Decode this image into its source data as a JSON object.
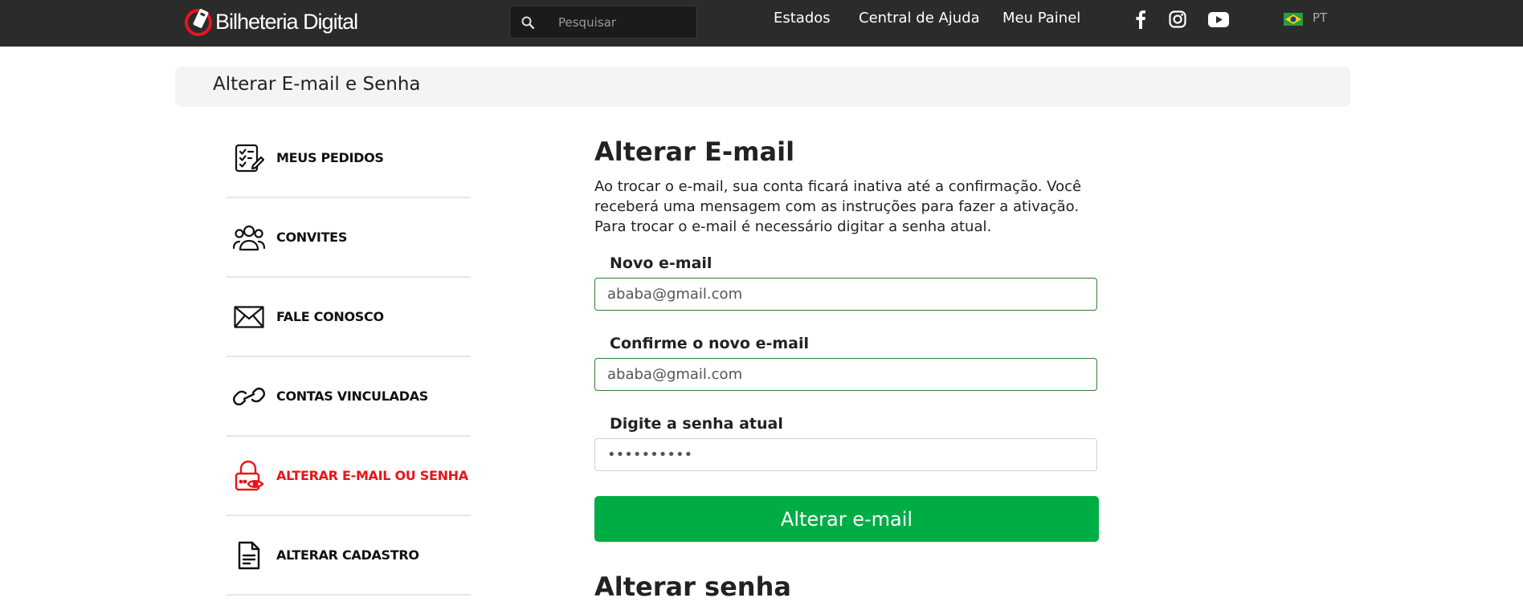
{
  "header": {
    "logo_text": "Bilheteria Digital",
    "search_placeholder": "Pesquisar",
    "nav": [
      "Estados",
      "Central de Ajuda",
      "Meu Painel"
    ],
    "language": "PT"
  },
  "page_title": "Alterar E-mail e Senha",
  "sidebar": {
    "items": [
      {
        "label": "MEUS PEDIDOS",
        "icon": "checklist-icon"
      },
      {
        "label": "CONVITES",
        "icon": "users-icon"
      },
      {
        "label": "FALE CONOSCO",
        "icon": "envelope-icon"
      },
      {
        "label": "CONTAS VINCULADAS",
        "icon": "link-icon"
      },
      {
        "label": "ALTERAR E-MAIL OU SENHA",
        "icon": "lock-eye-icon",
        "active": true
      },
      {
        "label": "ALTERAR CADASTRO",
        "icon": "document-icon"
      }
    ]
  },
  "form": {
    "title": "Alterar E-mail",
    "description": "Ao trocar o e-mail, sua conta ficará inativa até a confirmação. Você receberá uma mensagem com as instruções para fazer a ativação. Para trocar o e-mail é necessário digitar a senha atual.",
    "new_email_label": "Novo e-mail",
    "new_email_value": "ababa@gmail.com",
    "confirm_email_label": "Confirme o novo e-mail",
    "confirm_email_value": "ababa@gmail.com",
    "password_label": "Digite a senha atual",
    "password_value": "••••••••••",
    "submit_label": "Alterar e-mail"
  },
  "next_section_title": "Alterar senha",
  "colors": {
    "topbar": "#2b2b2b",
    "accent_red": "#e8141b",
    "button_green": "#00ad45",
    "input_border_green": "#2e7d32"
  }
}
